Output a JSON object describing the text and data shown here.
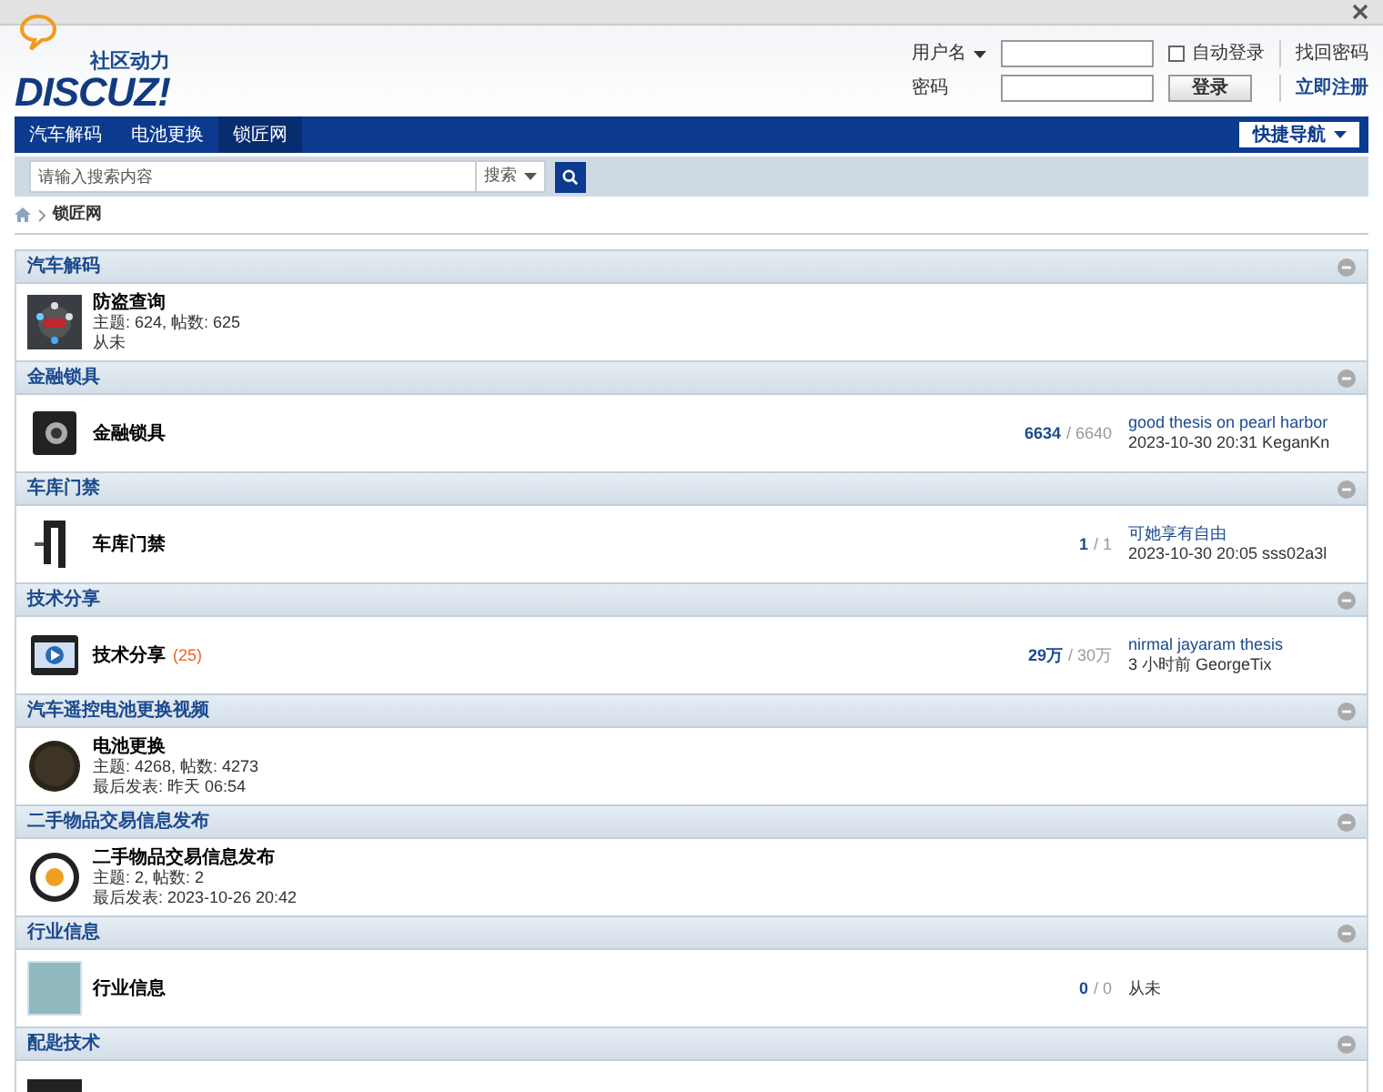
{
  "logo": {
    "tagline": "社区动力",
    "wordmark": "DISCUZ!"
  },
  "login": {
    "username_label": "用户名",
    "password_label": "密码",
    "remember": {
      "label": "自动登录",
      "checked": false
    },
    "forgot": "找回密码",
    "submit": "登录",
    "register": "立即注册"
  },
  "nav": {
    "items": [
      {
        "label": "汽车解码",
        "selected": false
      },
      {
        "label": "电池更换",
        "selected": false
      },
      {
        "label": "锁匠网",
        "selected": true
      }
    ],
    "quick_nav": "快捷导航"
  },
  "search": {
    "placeholder": "请输入搜索内容",
    "scope": "搜索"
  },
  "breadcrumb": {
    "current": "锁匠网"
  },
  "categories": [
    {
      "title": "汽车解码",
      "forums": [
        {
          "name": "防盗查询",
          "lines": [
            "主题: 624, 帖数: 625",
            "从未"
          ]
        }
      ]
    },
    {
      "title": "金融锁具",
      "forums": [
        {
          "name": "金融锁具",
          "threads": "6634",
          "posts": "/ 6640",
          "last_title": "good thesis on pearl harbor",
          "last_meta": "2023-10-30 20:31 KeganKn"
        }
      ]
    },
    {
      "title": "车库门禁",
      "forums": [
        {
          "name": "车库门禁",
          "threads": "1",
          "posts": "/ 1",
          "last_title": "可她享有自由",
          "last_meta": "2023-10-30 20:05 sss02a3l"
        }
      ]
    },
    {
      "title": "技术分享",
      "forums": [
        {
          "name": "技术分享",
          "new_count": "(25)",
          "threads": "29万",
          "posts": "/ 30万",
          "last_title": "nirmal jayaram thesis",
          "last_meta": "3 小时前 GeorgeTix"
        }
      ]
    },
    {
      "title": "汽车遥控电池更换视频",
      "forums": [
        {
          "name": "电池更换",
          "lines": [
            "主题: 4268, 帖数: 4273",
            "最后发表: 昨天 06:54"
          ]
        }
      ]
    },
    {
      "title": "二手物品交易信息发布",
      "forums": [
        {
          "name": "二手物品交易信息发布",
          "lines": [
            "主题: 2, 帖数: 2",
            "最后发表: 2023-10-26 20:42"
          ]
        }
      ]
    },
    {
      "title": "行业信息",
      "forums": [
        {
          "name": "行业信息",
          "threads": "0",
          "posts": "/ 0",
          "last_meta": "从未"
        }
      ]
    },
    {
      "title": "配匙技术"
    }
  ]
}
